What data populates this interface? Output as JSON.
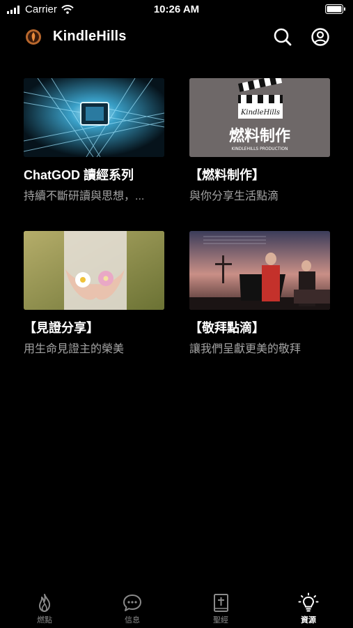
{
  "status_bar": {
    "carrier": "Carrier",
    "time": "10:26 AM"
  },
  "header": {
    "title": "KindleHills"
  },
  "cards": [
    {
      "title": "ChatGOD 讀經系列",
      "subtitle": "持續不斷研讀與思想，..."
    },
    {
      "title": "【燃料制作】",
      "subtitle": "與你分享生活點滴",
      "thumb_heading": "燃料制作",
      "thumb_caption": "KINDLEHILLS PRODUCTION",
      "thumb_logo_text": "KindleHills"
    },
    {
      "title": "【見證分享】",
      "subtitle": "用生命見證主的榮美"
    },
    {
      "title": "【敬拜點滴】",
      "subtitle": "讓我們呈獻更美的敬拜"
    }
  ],
  "tabs": [
    {
      "label": "燃點",
      "icon": "flame-icon",
      "active": false
    },
    {
      "label": "信息",
      "icon": "chat-bubble-icon",
      "active": false
    },
    {
      "label": "聖經",
      "icon": "bible-icon",
      "active": false
    },
    {
      "label": "資源",
      "icon": "lightbulb-icon",
      "active": true
    }
  ],
  "colors": {
    "background": "#000000",
    "subtitle": "#a3a3a3",
    "tab_inactive": "#8a8a8a",
    "tab_active": "#ffffff"
  }
}
